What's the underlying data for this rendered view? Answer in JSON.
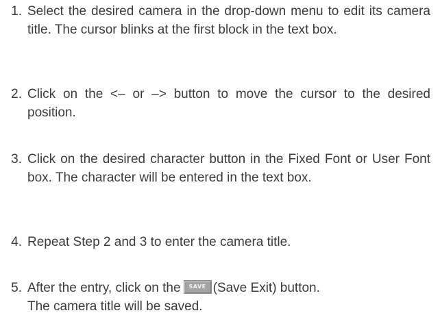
{
  "steps": [
    {
      "number": "1.",
      "text": "Select the desired camera in the drop-down menu to edit its camera title. The cursor blinks at the first block in the text box."
    },
    {
      "number": "2.",
      "text": "Click on the <– or –> button to move the cursor to the desired position."
    },
    {
      "number": "3.",
      "text": "Click on the desired character button in the Fixed Font or User Font box. The character will be entered in the text box."
    },
    {
      "number": "4.",
      "text": "Repeat Step 2 and 3 to enter the camera title."
    },
    {
      "number": "5.",
      "text_before": "After the entry, click on the",
      "button_label": "SAVE",
      "text_after": "(Save Exit) button.",
      "text_line2": "The camera title will be saved."
    }
  ]
}
